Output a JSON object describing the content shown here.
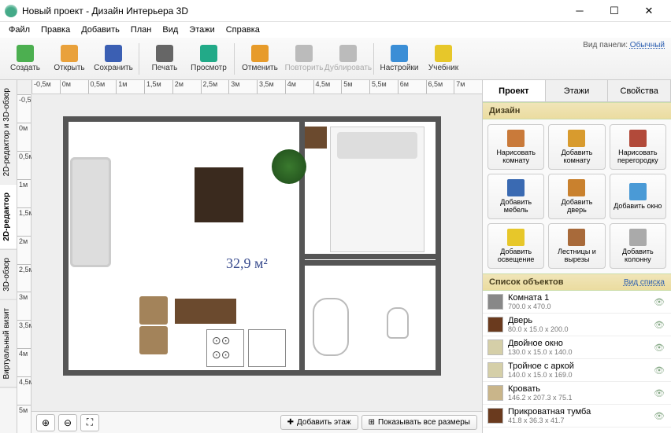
{
  "window": {
    "title": "Новый проект - Дизайн Интерьера 3D"
  },
  "menu": [
    "Файл",
    "Правка",
    "Добавить",
    "План",
    "Вид",
    "Этажи",
    "Справка"
  ],
  "toolbar": [
    {
      "label": "Создать",
      "c": "#4caf50"
    },
    {
      "label": "Открыть",
      "c": "#e9a13b"
    },
    {
      "label": "Сохранить",
      "c": "#3b5fb3"
    },
    {
      "sep": true
    },
    {
      "label": "Печать",
      "c": "#666"
    },
    {
      "label": "Просмотр",
      "c": "#2a8"
    },
    {
      "sep": true
    },
    {
      "label": "Отменить",
      "c": "#e79b2a"
    },
    {
      "label": "Повторить",
      "c": "#bbb",
      "dis": true
    },
    {
      "label": "Дублировать",
      "c": "#bbb",
      "dis": true
    },
    {
      "sep": true
    },
    {
      "label": "Настройки",
      "c": "#3b8ed6"
    },
    {
      "label": "Учебник",
      "c": "#e7c72a"
    }
  ],
  "panel_view": {
    "label": "Вид панели:",
    "value": "Обычный"
  },
  "vtabs": [
    "2D-редактор и 3D-обзор",
    "2D-редактор",
    "3D-обзор",
    "Виртуальный визит"
  ],
  "hruler": [
    "-0,5м",
    "0м",
    "0,5м",
    "1м",
    "1,5м",
    "2м",
    "2,5м",
    "3м",
    "3,5м",
    "4м",
    "4,5м",
    "5м",
    "5,5м",
    "6м",
    "6,5м",
    "7м"
  ],
  "vruler": [
    "-0,5м",
    "0м",
    "0,5м",
    "1м",
    "1,5м",
    "2м",
    "2,5м",
    "3м",
    "3,5м",
    "4м",
    "4,5м",
    "5м"
  ],
  "area": "32,9 м²",
  "bottom": {
    "add_floor": "Добавить этаж",
    "show_all": "Показывать все размеры"
  },
  "rtabs": [
    "Проект",
    "Этажи",
    "Свойства"
  ],
  "design_h": "Дизайн",
  "tools": [
    {
      "l": "Нарисовать комнату",
      "c": "#c97a3a"
    },
    {
      "l": "Добавить комнату",
      "c": "#d89b2e"
    },
    {
      "l": "Нарисовать перегородку",
      "c": "#b24a3a"
    },
    {
      "l": "Добавить мебель",
      "c": "#3a6ab2"
    },
    {
      "l": "Добавить дверь",
      "c": "#c9812e"
    },
    {
      "l": "Добавить окно",
      "c": "#4a9ad6"
    },
    {
      "l": "Добавить освещение",
      "c": "#e7c72a"
    },
    {
      "l": "Лестницы и вырезы",
      "c": "#a86a3a"
    },
    {
      "l": "Добавить колонну",
      "c": "#aaa"
    }
  ],
  "list_h": "Список объектов",
  "list_view": "Вид списка",
  "objects": [
    {
      "n": "Комната 1",
      "d": "700.0 x 470.0",
      "t": "#888"
    },
    {
      "n": "Дверь",
      "d": "80.0 x 15.0 x 200.0",
      "t": "#6a3a1e"
    },
    {
      "n": "Двойное окно",
      "d": "130.0 x 15.0 x 140.0",
      "t": "#d5cfa8"
    },
    {
      "n": "Тройное с аркой",
      "d": "140.0 x 15.0 x 169.0",
      "t": "#d5cfa8"
    },
    {
      "n": "Кровать",
      "d": "146.2 x 207.3 x 75.1",
      "t": "#c9b58a"
    },
    {
      "n": "Прикроватная тумба",
      "d": "41.8 x 36.3 x 41.7",
      "t": "#6a3a1e"
    }
  ]
}
